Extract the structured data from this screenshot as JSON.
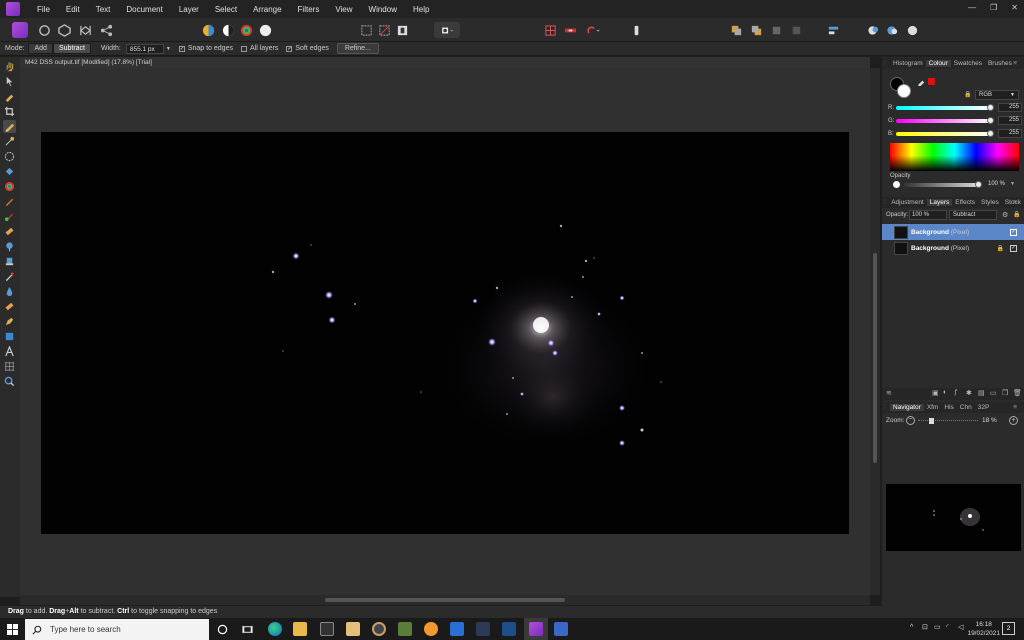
{
  "menu": [
    "File",
    "Edit",
    "Text",
    "Document",
    "Layer",
    "Select",
    "Arrange",
    "Filters",
    "View",
    "Window",
    "Help"
  ],
  "window_controls": [
    "—",
    "❐",
    "✕"
  ],
  "context": {
    "mode_label": "Mode:",
    "mode_add": "Add",
    "mode_subtract": "Subtract",
    "width_label": "Width:",
    "width_value": "855.1 px",
    "snap_edges": "Snap to edges",
    "all_layers": "All layers",
    "soft_edges": "Soft edges",
    "refine": "Refine..."
  },
  "document": {
    "title": "M42 DSS output.tif [Modified] (17.8%) [Trial]"
  },
  "color_panel": {
    "tabs": [
      "Histogram",
      "Colour",
      "Swatches",
      "Brushes"
    ],
    "active_tab": "Colour",
    "mode": "RGB",
    "r_label": "R:",
    "r": "255",
    "g_label": "G:",
    "g": "255",
    "b_label": "B:",
    "b": "255",
    "opacity_label": "Opacity",
    "opacity_value": "100 %",
    "opacity_fraction": 1.0
  },
  "layers_panel": {
    "tabs": [
      "Adjustment",
      "Layers",
      "Effects",
      "Styles",
      "Stock"
    ],
    "active_tab": "Layers",
    "opacity_label": "Opacity:",
    "opacity_value": "100 %",
    "blend_mode": "Subtract",
    "layers": [
      {
        "name": "Background",
        "type": "(Pixel)",
        "selected": true
      },
      {
        "name": "Background",
        "type": "(Pixel)",
        "selected": false,
        "locked": true
      }
    ]
  },
  "navigator_panel": {
    "tabs": [
      "Navigator",
      "Xfm",
      "His",
      "Chn",
      "32P"
    ],
    "active_tab": "Navigator",
    "zoom_label": "Zoom:",
    "zoom_value": "18 %"
  },
  "status": {
    "drag": "Drag",
    "t1": " to add. ",
    "drag_alt": "Drag",
    "plus": "+",
    "alt": "Alt",
    "t2": " to subtract. ",
    "ctrl": "Ctrl",
    "t3": " to toggle snapping to edges"
  },
  "taskbar": {
    "search_placeholder": "Type here to search",
    "time": "16:18",
    "date": "19/02/2021",
    "notifications": "2"
  },
  "colors": {
    "accent": "#5b87c9",
    "app_purple": "#9b44d0"
  }
}
